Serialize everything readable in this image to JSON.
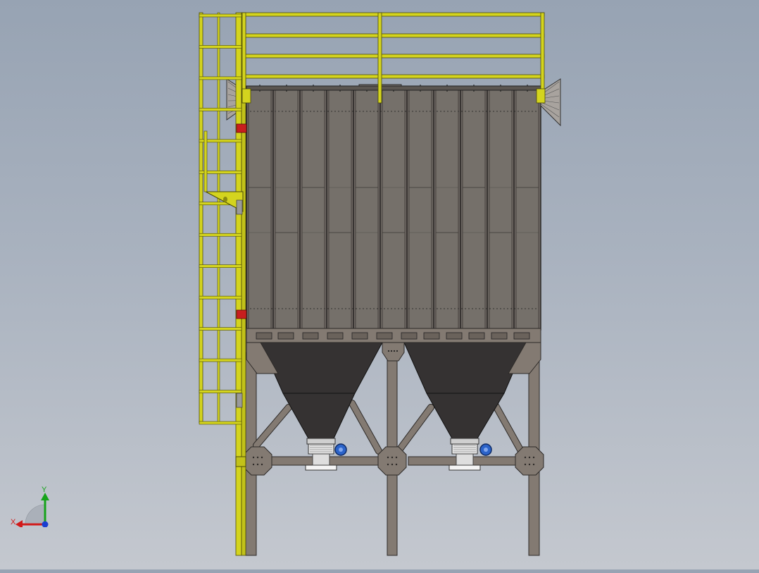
{
  "viewport": {
    "background_top": "#97a3b3",
    "background_bottom": "#c4c8cf"
  },
  "model": {
    "colors": {
      "yellow_steel": "#d4d41e",
      "yellow_edge": "#4a4a08",
      "housing": "#6e6863",
      "housing_edge": "#2a2826",
      "hopper": "#353232",
      "frame": "#837a72",
      "frame_edge": "#2d2a28",
      "red_marker": "#c81e1e",
      "blue_valve": "#2b63c9"
    },
    "filter_columns": 11,
    "hoppers": 2,
    "ladder_rungs": 14,
    "red_markers": 2,
    "blue_valves": 2
  },
  "triad": {
    "x_label": "X",
    "y_label": "Y",
    "x_color": "#d11a1a",
    "y_color": "#16a31a",
    "z_color": "#1a3fd1"
  }
}
